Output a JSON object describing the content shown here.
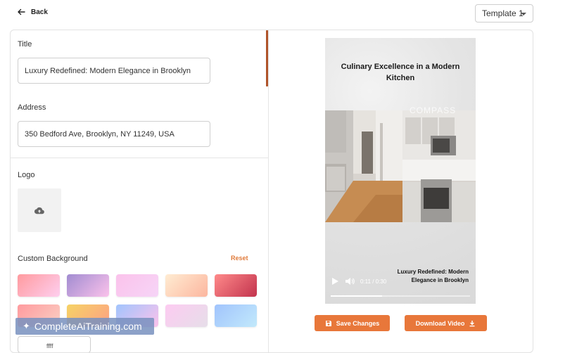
{
  "header": {
    "back_label": "Back",
    "template_selected": "Template 1"
  },
  "form": {
    "title_label": "Title",
    "title_value": "Luxury Redefined: Modern Elegance in Brooklyn",
    "address_label": "Address",
    "address_value": "350 Bedford Ave, Brooklyn, NY 11249, USA",
    "logo_label": "Logo",
    "background_label": "Custom Background",
    "reset_label": "Reset",
    "bottom_input_value": "ffff"
  },
  "swatches": [
    {
      "name": "swatch-pink-coral",
      "from": "#ff9a9e",
      "to": "#fecfef"
    },
    {
      "name": "swatch-lavender",
      "from": "#a18cd1",
      "to": "#fbc2eb"
    },
    {
      "name": "swatch-light-pink",
      "from": "#fbc2eb",
      "to": "#f6d5f7"
    },
    {
      "name": "swatch-peach",
      "from": "#ffecd2",
      "to": "#fcb69f"
    },
    {
      "name": "swatch-red-rose",
      "from": "#ff8a8a",
      "to": "#c2334d"
    },
    {
      "name": "swatch-pink-light",
      "from": "#ff9a9e",
      "to": "#fad0c4"
    },
    {
      "name": "swatch-orange-yellow",
      "from": "#f6d365",
      "to": "#fda085"
    },
    {
      "name": "swatch-blue-pink",
      "from": "#a1c4fd",
      "to": "#fbc2eb"
    },
    {
      "name": "swatch-pale-pink",
      "from": "#fdcbf1",
      "to": "#e6dee9"
    },
    {
      "name": "swatch-sky-blue",
      "from": "#a1c4fd",
      "to": "#c2e9fb"
    }
  ],
  "preview": {
    "title": "Culinary Excellence in a Modern Kitchen",
    "brand": "COMPASS",
    "caption": "Luxury Redefined: Modern Elegance in Brooklyn",
    "time": "0:11 / 0:30",
    "progress_fraction": 0.37
  },
  "actions": {
    "save_label": "Save Changes",
    "download_label": "Download Video"
  },
  "watermark": {
    "text": "CompleteAiTraining.com"
  }
}
